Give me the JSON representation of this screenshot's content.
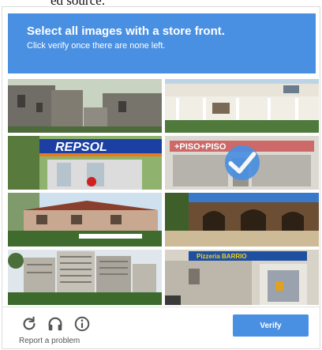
{
  "page": {
    "top_cut_text": "ed source:"
  },
  "header": {
    "title_prefix": "Select all images with a ",
    "title_keyword": "store front",
    "title_suffix": ".",
    "subtitle": "Click verify once there are none left."
  },
  "tiles": [
    {
      "id": 1,
      "description_icon": "stone-castle-image",
      "selected": false,
      "sign_text": ""
    },
    {
      "id": 2,
      "description_icon": "white-house-porch-image",
      "selected": false,
      "sign_text": ""
    },
    {
      "id": 3,
      "description_icon": "gas-station-image",
      "selected": false,
      "sign_text": "REPSOL"
    },
    {
      "id": 4,
      "description_icon": "piso-store-image",
      "selected": true,
      "sign_text": "+PISO+PISO"
    },
    {
      "id": 5,
      "description_icon": "red-roof-house-image",
      "selected": false,
      "sign_text": ""
    },
    {
      "id": 6,
      "description_icon": "stone-arches-image",
      "selected": false,
      "sign_text": ""
    },
    {
      "id": 7,
      "description_icon": "apartment-towers-image",
      "selected": false,
      "sign_text": ""
    },
    {
      "id": 8,
      "description_icon": "pizzeria-storefront-image",
      "selected": false,
      "sign_text": "Pizzeria BARRIO"
    }
  ],
  "footer": {
    "reload_icon": "reload-icon",
    "audio_icon": "headphones-icon",
    "info_icon": "info-icon",
    "report_label": "Report a problem",
    "verify_label": "Verify"
  },
  "colors": {
    "accent": "#4a90e2",
    "white": "#ffffff",
    "divider": "#e2e2e2"
  }
}
